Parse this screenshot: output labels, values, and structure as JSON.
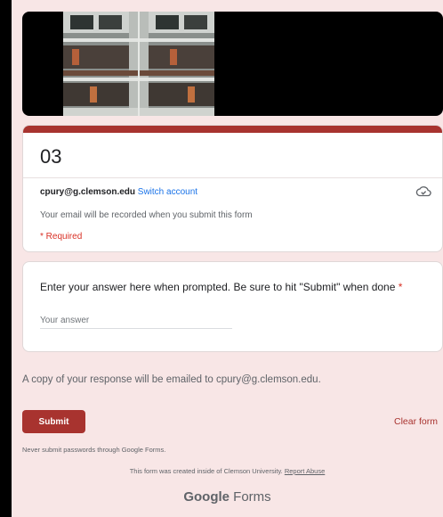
{
  "form": {
    "title": "03",
    "account_email": "cpury@g.clemson.edu",
    "switch_account": "Switch account",
    "email_note": "Your email will be recorded when you submit this form",
    "required_note": "* Required"
  },
  "question": {
    "label": "Enter your answer here when prompted. Be sure to hit \"Submit\" when done",
    "required_marker": "*",
    "answer_placeholder": "Your answer",
    "answer_value": ""
  },
  "copy_note": "A copy of your response will be emailed to cpury@g.clemson.edu.",
  "actions": {
    "submit_label": "Submit",
    "clear_label": "Clear form"
  },
  "footer": {
    "password_warning": "Never submit passwords through Google Forms.",
    "created_note": "This form was created inside of Clemson University.",
    "report_abuse": "Report Abuse",
    "logo_google": "Google",
    "logo_forms": "Forms"
  },
  "icons": {
    "cloud": "cloud-saved-icon"
  },
  "colors": {
    "accent": "#a8332f",
    "page_background": "#f8e6e6",
    "link": "#1a73e8",
    "required": "#d93025"
  }
}
